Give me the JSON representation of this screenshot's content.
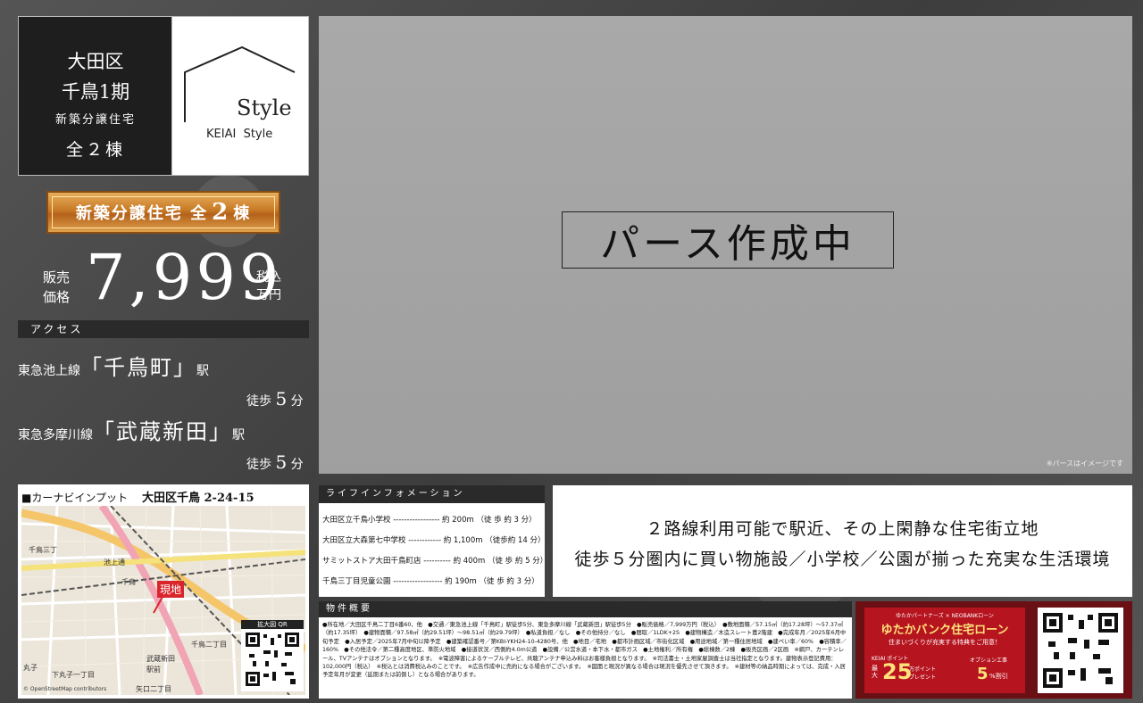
{
  "title_box": {
    "ward": "大田区",
    "area": "千鳥1期",
    "type": "新築分譲住宅",
    "count": "全２棟"
  },
  "logo": {
    "style": "Style",
    "brand": "KEIAI  Style"
  },
  "banner": {
    "prefix": "新築分譲住宅 全",
    "number": "2",
    "suffix": "棟"
  },
  "price": {
    "label_top": "販売",
    "label_bottom": "価格",
    "value": "7,999",
    "unit_top": "税込",
    "unit_bottom": "万円"
  },
  "access": {
    "heading": "アクセス",
    "stations": [
      {
        "line": "東急池上線",
        "open": "「",
        "name": "千鳥町",
        "close": "」",
        "suffix": "駅",
        "walk_pre": "徒歩",
        "walk_n": "5",
        "walk_unit": "分"
      },
      {
        "line": "東急多摩川線",
        "open": "「",
        "name": "武蔵新田",
        "close": "」",
        "suffix": "駅",
        "walk_pre": "徒歩",
        "walk_n": "5",
        "walk_unit": "分"
      }
    ]
  },
  "perse": {
    "text": "パース作成中",
    "note": "※パースはイメージです"
  },
  "map": {
    "heading": "■カーナビインプット",
    "address": "大田区千鳥 2-24-15",
    "pin": "現地",
    "qr_label": "拡大図 QR",
    "labels": [
      "千鳥三丁",
      "池上通",
      "千鳥",
      "千鳥二丁目",
      "武蔵新田",
      "駅前",
      "矢口二丁目",
      "丸子",
      "下丸子一丁目"
    ],
    "credit": "© OpenStreetMap contributors"
  },
  "lifeline": {
    "heading": "ライフインフォメーション",
    "rows": [
      "大田区立千鳥小学校 ----------------- 約 200m （徒 歩 約 3 分）",
      "大田区立大森第七中学校 ------------ 約 1,100m （徒歩約 14 分）",
      "サミットストア大田千鳥町店 ---------- 約 400m （徒 歩 約 5 分）",
      "千鳥三丁目児童公園 ------------------ 約 190m （徒 歩 約 3 分）"
    ]
  },
  "tagline": {
    "line1": "２路線利用可能で駅近、その上閑静な住宅街立地",
    "line2": "徒歩５分圏内に買い物施設／小学校／公園が揃った充実な生活環境"
  },
  "summary": {
    "heading": "物件概要",
    "body": "●所在地／大田区千鳥二丁目6番60、他　●交通／東急池上線「千鳥町」駅徒歩5分、東急多摩川線「武蔵新田」駅徒歩5分　●販売価格／7,999万円（税込）　●敷地面積／57.15㎡（約17.28坪）～57.37㎡（約17.35坪）　●建物面積／97.58㎡（約29.51坪）～98.51㎡（約29.79坪）　●私道負担／なし　●その他持分／なし　●間取／1LDK+2S　●建物構造／木造スレート葺2階建　●完成年月／2025年6月中旬予定　●入居予定／2025年7月中旬以降予定　●建築確認番号／第KBI-YKH24-10-4280号、他　●地目／宅地　●都市計画区域／市街化区域　●用途地域／第一種住居地域　●建ぺい率／60%　●容積率／160%　●その他法令／第二種高度地区、準防火地域　●接道状況／西側約4.0m公道　●設備／公営水道・本下水・都市ガス　●土地権利／所有権　●総棟数／2棟　●販売区画／2区画　※網戸、カーテンレール、TVアンテナはオプションとなります。　※電波障害によるケーブルテレビ、共聴アンテナ申込み料はお客様負担となります。　※司法書士・土地家屋調査士は当社指定となります。建物表示登記費用：102,000円（税込）　※税込とは消費税込みのことです。　※広告作成中に売約になる場合がございます。　※図面と現況が異なる場合は現況を優先させて頂きます。　※建材等の納品時期によっては、完成・入居予定年月が変更（延期または前倒し）となる場合があります。"
  },
  "bank": {
    "partners": "ゆたかパートナーズ × NEOBANKローン",
    "title": "ゆたかバンク住宅ローン",
    "sub": "住まいづくりが充実する特典をご用意！",
    "points_label": "KEIAI ポイント",
    "points_pre": "最大",
    "points_num": "25",
    "points_unit": "万ポイント",
    "points_gift": "プレゼント",
    "option_label": "オプション工事",
    "option_num": "5",
    "option_unit": "%割引"
  },
  "colors": {
    "gold": "#c87a26",
    "dark": "#1e1e1e",
    "bank_red": "#b6141f",
    "pin_red": "#d9262c"
  }
}
